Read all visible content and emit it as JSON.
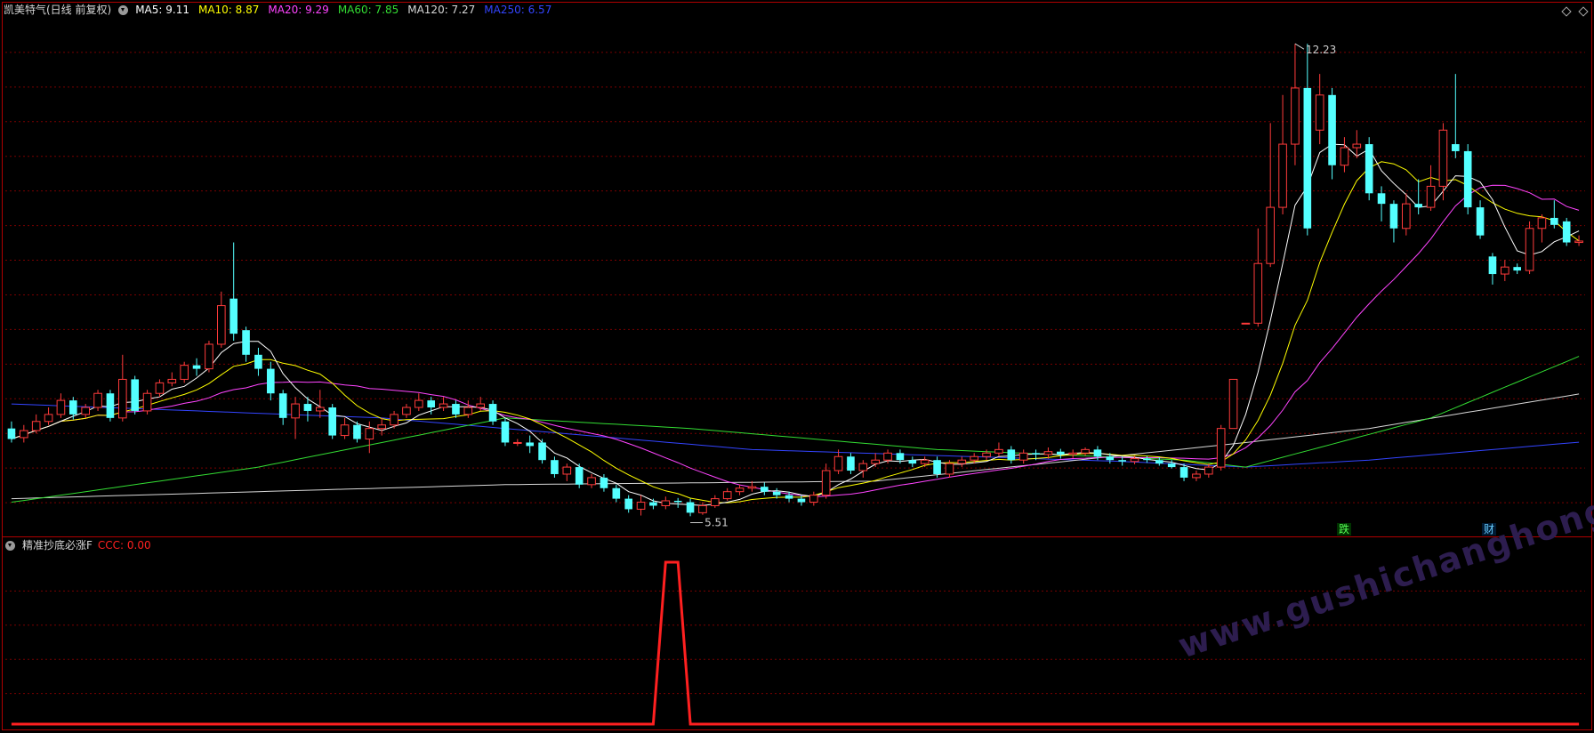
{
  "header": {
    "title": "凯美特气(日线 前复权)",
    "ma": [
      {
        "label": "MA5: 9.11",
        "color": "#ffffff"
      },
      {
        "label": "MA10: 8.87",
        "color": "#ffff00"
      },
      {
        "label": "MA20: 9.29",
        "color": "#ff44ff"
      },
      {
        "label": "MA60: 7.85",
        "color": "#33dd33"
      },
      {
        "label": "MA120: 7.27",
        "color": "#d8d8d8"
      },
      {
        "label": "MA250: 6.57",
        "color": "#3344ff"
      }
    ]
  },
  "indicator": {
    "name": "精准抄底必涨F",
    "value_label": "CCC: 0.00",
    "color": "#ff2020"
  },
  "annotations": {
    "high_label": "12.23",
    "low_label": "5.51",
    "event_1": "跌",
    "event_2": "财"
  },
  "colors": {
    "up": "#ff3b3b",
    "down": "#54ffff",
    "border": "#b00000",
    "grid": "#7a0000"
  },
  "watermark": "www.gushichanghong.com",
  "chart_data": [
    {
      "type": "candlestick",
      "title": "凯美特气(日线 前复权)",
      "ylim": [
        5.2,
        12.6
      ],
      "high": 12.23,
      "low": 5.51,
      "candles": [
        [
          6.75,
          6.6,
          6.85,
          6.55
        ],
        [
          6.62,
          6.72,
          6.8,
          6.55
        ],
        [
          6.72,
          6.85,
          6.95,
          6.68
        ],
        [
          6.85,
          6.95,
          7.05,
          6.8
        ],
        [
          6.95,
          7.15,
          7.25,
          6.9
        ],
        [
          7.15,
          6.95,
          7.2,
          6.88
        ],
        [
          6.95,
          7.05,
          7.1,
          6.9
        ],
        [
          7.05,
          7.25,
          7.3,
          7.0
        ],
        [
          7.25,
          6.9,
          7.3,
          6.85
        ],
        [
          6.9,
          7.45,
          7.8,
          6.85
        ],
        [
          7.45,
          7.0,
          7.5,
          6.95
        ],
        [
          7.0,
          7.25,
          7.3,
          6.95
        ],
        [
          7.25,
          7.4,
          7.45,
          7.2
        ],
        [
          7.4,
          7.45,
          7.55,
          7.35
        ],
        [
          7.45,
          7.65,
          7.7,
          7.4
        ],
        [
          7.65,
          7.6,
          7.75,
          7.5
        ],
        [
          7.6,
          7.95,
          8.0,
          7.55
        ],
        [
          7.95,
          8.5,
          8.7,
          7.9
        ],
        [
          8.6,
          8.1,
          9.4,
          8.0
        ],
        [
          8.15,
          7.8,
          8.2,
          7.7
        ],
        [
          7.8,
          7.6,
          7.9,
          7.5
        ],
        [
          7.6,
          7.25,
          7.7,
          7.15
        ],
        [
          7.25,
          6.9,
          7.3,
          6.8
        ],
        [
          6.9,
          7.1,
          7.2,
          6.6
        ],
        [
          7.1,
          7.0,
          7.2,
          6.85
        ],
        [
          7.0,
          7.05,
          7.3,
          6.9
        ],
        [
          7.05,
          6.65,
          7.1,
          6.6
        ],
        [
          6.65,
          6.8,
          6.9,
          6.6
        ],
        [
          6.8,
          6.6,
          6.85,
          6.55
        ],
        [
          6.6,
          6.75,
          6.85,
          6.4
        ],
        [
          6.75,
          6.8,
          6.9,
          6.65
        ],
        [
          6.8,
          6.95,
          7.0,
          6.75
        ],
        [
          6.95,
          7.05,
          7.1,
          6.9
        ],
        [
          7.05,
          7.15,
          7.25,
          7.0
        ],
        [
          7.15,
          7.05,
          7.2,
          6.95
        ],
        [
          7.05,
          7.1,
          7.2,
          7.0
        ],
        [
          7.1,
          6.95,
          7.15,
          6.9
        ],
        [
          6.95,
          7.05,
          7.15,
          6.9
        ],
        [
          7.05,
          7.1,
          7.2,
          7.0
        ],
        [
          7.1,
          6.85,
          7.15,
          6.8
        ],
        [
          6.85,
          6.55,
          6.9,
          6.5
        ],
        [
          6.55,
          6.55,
          6.6,
          6.5
        ],
        [
          6.55,
          6.5,
          6.65,
          6.4
        ],
        [
          6.55,
          6.3,
          6.6,
          6.25
        ],
        [
          6.3,
          6.1,
          6.35,
          6.05
        ],
        [
          6.1,
          6.2,
          6.25,
          6.0
        ],
        [
          6.2,
          5.95,
          6.25,
          5.9
        ],
        [
          5.95,
          6.05,
          6.1,
          5.9
        ],
        [
          6.05,
          5.9,
          6.1,
          5.85
        ],
        [
          5.9,
          5.75,
          5.95,
          5.7
        ],
        [
          5.75,
          5.6,
          5.8,
          5.55
        ],
        [
          5.6,
          5.7,
          5.8,
          5.51
        ],
        [
          5.7,
          5.65,
          5.75,
          5.6
        ],
        [
          5.65,
          5.72,
          5.78,
          5.6
        ],
        [
          5.72,
          5.7,
          5.76,
          5.62
        ],
        [
          5.7,
          5.55,
          5.75,
          5.5
        ],
        [
          5.55,
          5.65,
          5.7,
          5.52
        ],
        [
          5.65,
          5.75,
          5.8,
          5.62
        ],
        [
          5.75,
          5.85,
          5.9,
          5.72
        ],
        [
          5.85,
          5.9,
          5.95,
          5.8
        ],
        [
          5.9,
          5.92,
          6.0,
          5.85
        ],
        [
          5.92,
          5.85,
          5.98,
          5.8
        ],
        [
          5.85,
          5.8,
          5.9,
          5.75
        ],
        [
          5.8,
          5.75,
          5.85,
          5.7
        ],
        [
          5.75,
          5.7,
          5.8,
          5.65
        ],
        [
          5.7,
          5.8,
          5.85,
          5.65
        ],
        [
          5.8,
          6.15,
          6.25,
          5.75
        ],
        [
          6.15,
          6.35,
          6.45,
          6.1
        ],
        [
          6.35,
          6.15,
          6.4,
          6.1
        ],
        [
          6.15,
          6.25,
          6.3,
          6.05
        ],
        [
          6.25,
          6.3,
          6.4,
          6.2
        ],
        [
          6.3,
          6.4,
          6.45,
          6.25
        ],
        [
          6.4,
          6.3,
          6.45,
          6.25
        ],
        [
          6.3,
          6.25,
          6.35,
          6.2
        ],
        [
          6.25,
          6.3,
          6.35,
          6.2
        ],
        [
          6.3,
          6.1,
          6.35,
          6.05
        ],
        [
          6.1,
          6.25,
          6.3,
          6.05
        ],
        [
          6.25,
          6.3,
          6.35,
          6.2
        ],
        [
          6.3,
          6.35,
          6.4,
          6.25
        ],
        [
          6.35,
          6.4,
          6.45,
          6.3
        ],
        [
          6.4,
          6.45,
          6.55,
          6.35
        ],
        [
          6.45,
          6.3,
          6.5,
          6.25
        ],
        [
          6.3,
          6.4,
          6.45,
          6.25
        ],
        [
          6.4,
          6.38,
          6.45,
          6.3
        ],
        [
          6.38,
          6.42,
          6.48,
          6.32
        ],
        [
          6.42,
          6.38,
          6.46,
          6.32
        ],
        [
          6.38,
          6.4,
          6.45,
          6.33
        ],
        [
          6.4,
          6.45,
          6.48,
          6.36
        ],
        [
          6.45,
          6.35,
          6.5,
          6.3
        ],
        [
          6.35,
          6.3,
          6.4,
          6.25
        ],
        [
          6.3,
          6.28,
          6.35,
          6.22
        ],
        [
          6.28,
          6.32,
          6.36,
          6.24
        ],
        [
          6.32,
          6.3,
          6.36,
          6.26
        ],
        [
          6.3,
          6.25,
          6.34,
          6.22
        ],
        [
          6.25,
          6.2,
          6.3,
          6.18
        ],
        [
          6.2,
          6.05,
          6.25,
          6.0
        ],
        [
          6.05,
          6.1,
          6.15,
          6.0
        ],
        [
          6.1,
          6.2,
          6.25,
          6.05
        ],
        [
          6.2,
          6.75,
          6.8,
          6.15
        ],
        [
          6.75,
          7.45,
          7.45,
          6.75
        ],
        [
          8.25,
          8.25,
          8.25,
          8.25
        ],
        [
          8.25,
          9.1,
          9.6,
          8.2
        ],
        [
          9.1,
          9.9,
          11.1,
          9.05
        ],
        [
          9.9,
          10.8,
          11.5,
          9.8
        ],
        [
          10.8,
          11.6,
          12.23,
          10.5
        ],
        [
          11.6,
          9.6,
          12.23,
          9.5
        ],
        [
          11.0,
          11.5,
          11.8,
          10.8
        ],
        [
          11.5,
          10.5,
          11.6,
          10.3
        ],
        [
          10.5,
          10.75,
          10.9,
          10.4
        ],
        [
          10.75,
          10.8,
          11.0,
          10.6
        ],
        [
          10.8,
          10.1,
          10.9,
          10.0
        ],
        [
          10.1,
          9.95,
          10.2,
          9.7
        ],
        [
          9.95,
          9.6,
          10.0,
          9.4
        ],
        [
          9.6,
          9.95,
          10.1,
          9.5
        ],
        [
          9.95,
          9.9,
          10.3,
          9.8
        ],
        [
          9.9,
          10.2,
          10.5,
          9.85
        ],
        [
          10.2,
          11.0,
          11.1,
          10.0
        ],
        [
          10.8,
          10.7,
          11.8,
          10.6
        ],
        [
          10.7,
          9.9,
          10.8,
          9.8
        ],
        [
          9.9,
          9.5,
          10.0,
          9.45
        ],
        [
          9.2,
          8.95,
          9.25,
          8.8
        ],
        [
          8.95,
          9.05,
          9.15,
          8.85
        ],
        [
          9.05,
          9.0,
          9.1,
          8.95
        ],
        [
          9.0,
          9.6,
          9.7,
          8.95
        ],
        [
          9.6,
          9.75,
          9.8,
          9.4
        ],
        [
          9.75,
          9.65,
          10.0,
          9.6
        ],
        [
          9.7,
          9.4,
          9.75,
          9.35
        ],
        [
          9.4,
          9.42,
          9.5,
          9.35
        ]
      ],
      "ma_values": {
        "MA5": 9.11,
        "MA10": 8.87,
        "MA20": 9.29,
        "MA60": 7.85,
        "MA120": 7.27,
        "MA250": 6.57
      }
    },
    {
      "type": "line",
      "title": "精准抄底必涨F",
      "series": [
        {
          "name": "CCC",
          "values_by_index": {
            "53": 1,
            "54": 1
          }
        }
      ]
    }
  ]
}
